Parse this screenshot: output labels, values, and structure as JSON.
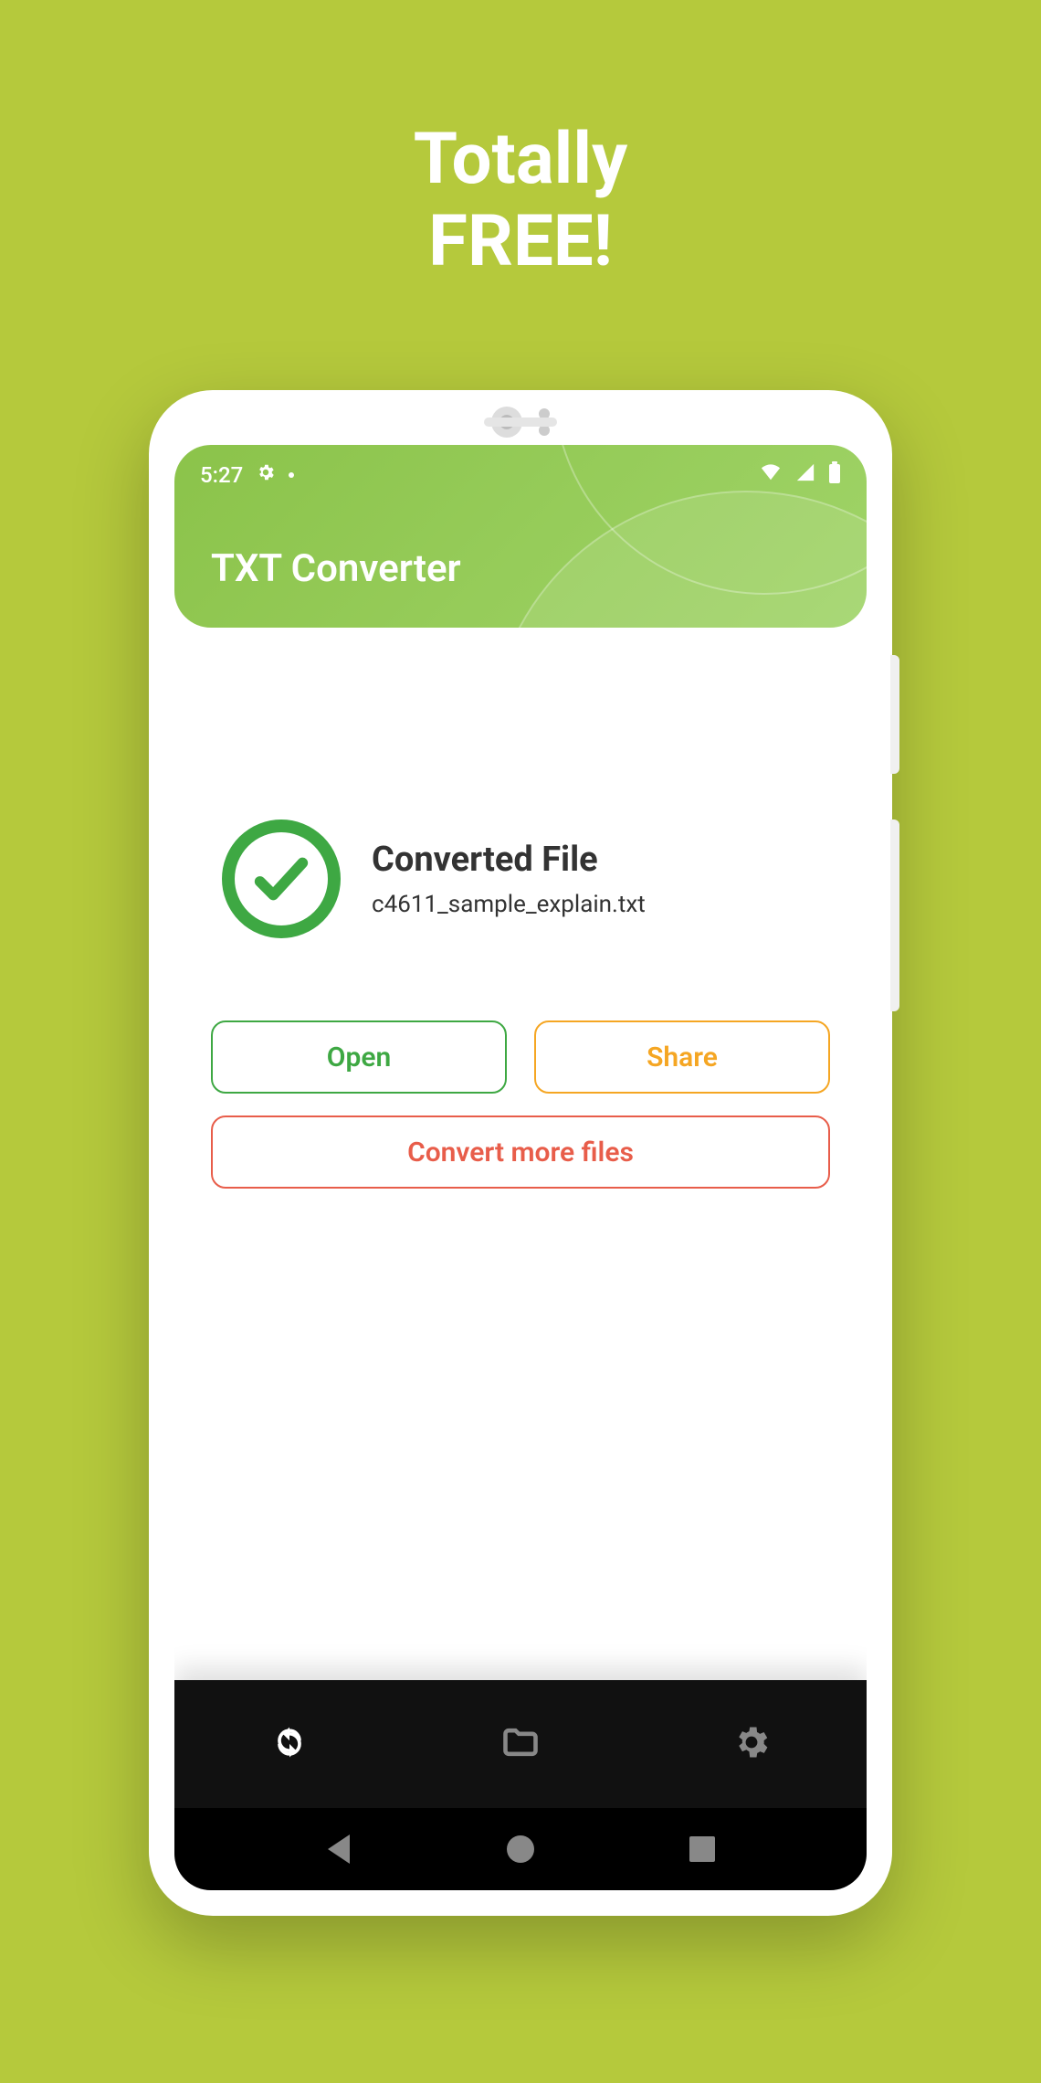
{
  "promo": {
    "line1": "Totally",
    "line2": "FREE!"
  },
  "statusbar": {
    "time": "5:27"
  },
  "header": {
    "title": "TXT Converter"
  },
  "result": {
    "heading": "Converted File",
    "filename": "c4611_sample_explain.txt"
  },
  "buttons": {
    "open": "Open",
    "share": "Share",
    "convert_more": "Convert more files"
  }
}
